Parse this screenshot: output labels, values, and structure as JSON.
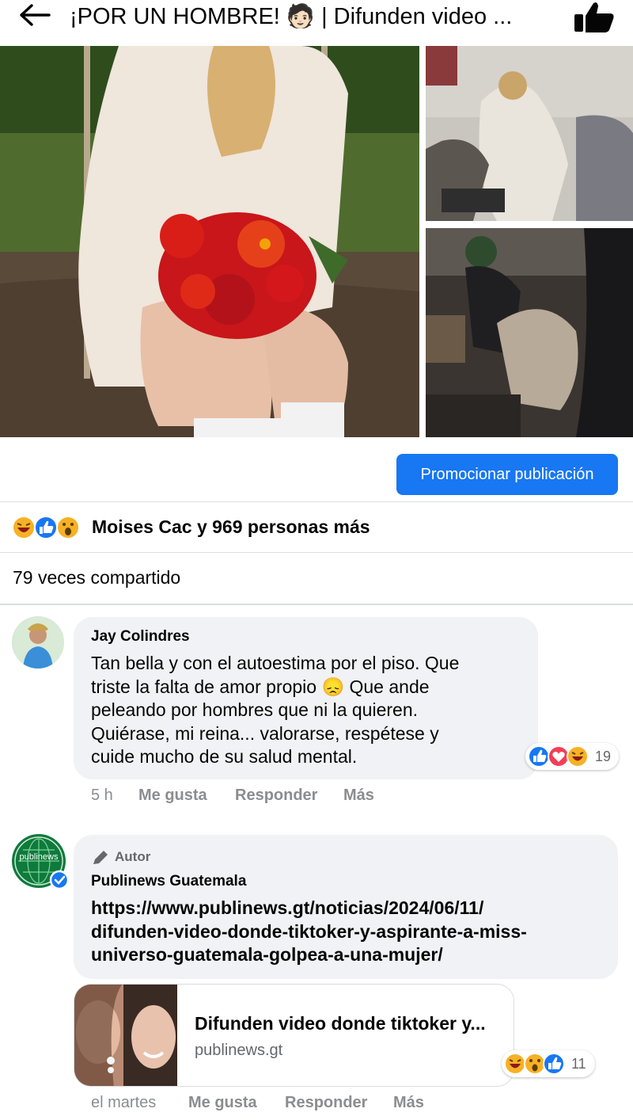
{
  "header": {
    "title": "¡POR UN HOMBRE! 🧑🏻 | Difunden video ...",
    "back_icon": "back-arrow-icon",
    "like_icon": "thumbs-up-icon"
  },
  "post": {
    "promote_label": "Promocionar publicación",
    "reactions_text": "Moises Cac y 969 personas más",
    "reaction_icons": [
      "haha-icon",
      "like-icon",
      "wow-icon"
    ],
    "shares_text": "79 veces compartido"
  },
  "comments": [
    {
      "author": "Jay Colindres",
      "text_lines": [
        "Tan bella y con el autoestima por el piso. Que",
        "triste la falta de amor propio 😞 Que ande",
        "peleando por hombres que ni la quieren.",
        "Quiérase, mi reina... valorarse, respétese y",
        "cuide mucho de su salud mental."
      ],
      "reaction_count": "19",
      "reaction_icons": [
        "like-icon",
        "love-icon",
        "haha-icon"
      ],
      "time": "5 h",
      "like_label": "Me gusta",
      "reply_label": "Responder",
      "more_label": "Más"
    },
    {
      "tag": "Autor",
      "author": "Publinews Guatemala",
      "avatar_text": "publinews",
      "text_lines": [
        "https://www.publinews.gt/noticias/2024/06/11/",
        "difunden-video-donde-tiktoker-y-aspirante-a-miss-",
        "universo-guatemala-golpea-a-una-mujer/"
      ],
      "link_title": "Difunden video donde tiktoker y...",
      "link_domain": "publinews.gt",
      "reaction_count": "11",
      "reaction_icons": [
        "haha-icon",
        "wow-icon",
        "like-icon"
      ],
      "time": "el martes",
      "like_label": "Me gusta",
      "reply_label": "Responder",
      "more_label": "Más"
    }
  ],
  "colors": {
    "accent": "#1877f2",
    "bubble": "#f0f2f5",
    "muted": "#8a8d91",
    "divider": "#dadde1"
  }
}
